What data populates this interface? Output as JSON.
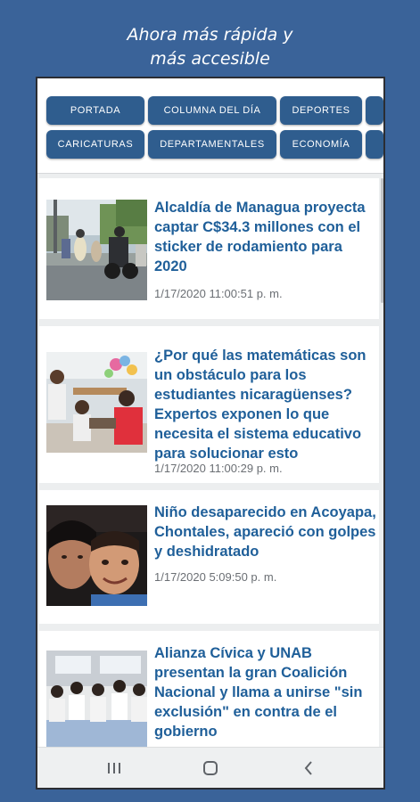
{
  "tagline": {
    "line1": "Ahora más rápida y",
    "line2": "más accesible"
  },
  "categories": {
    "row1": [
      "PORTADA",
      "COLUMNA DEL DÍA",
      "DEPORTES"
    ],
    "row2": [
      "CARICATURAS",
      "DEPARTAMENTALES",
      "ECONOMÍA"
    ]
  },
  "articles": [
    {
      "title": "Alcaldía de Managua proyecta captar C$34.3 millones con el sticker de rodamiento para 2020",
      "timestamp": "1/17/2020 11:00:51 p. m."
    },
    {
      "title": "¿Por qué las matemáticas son un obstáculo para los estudiantes nicaragüenses? Expertos exponen lo que necesita el sistema educativo para solucionar esto",
      "timestamp": "1/17/2020 11:00:29 p. m."
    },
    {
      "title": "Niño desaparecido en Acoyapa, Chontales, apareció con golpes y deshidratado",
      "timestamp": "1/17/2020 5:09:50 p. m."
    },
    {
      "title": "Alianza Cívica y UNAB presentan la gran Coalición Nacional y llama a unirse \"sin exclusión\" en contra de el gobierno",
      "timestamp": ""
    }
  ],
  "colors": {
    "background": "#3a6399",
    "chip": "#2f5d8e",
    "headline": "#1f5f99"
  },
  "icons": {
    "nav_recent": "recent-apps-icon",
    "nav_home": "home-icon",
    "nav_back": "back-icon"
  }
}
